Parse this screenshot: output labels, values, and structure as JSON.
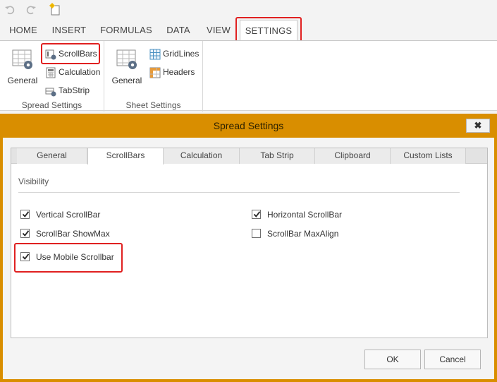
{
  "quick_access": {
    "icons": [
      "undo-icon",
      "redo-icon",
      "new-file-icon"
    ]
  },
  "ribbon_tabs": [
    {
      "label": "HOME"
    },
    {
      "label": "INSERT"
    },
    {
      "label": "FORMULAS"
    },
    {
      "label": "DATA"
    },
    {
      "label": "VIEW"
    },
    {
      "label": "SETTINGS",
      "active": true
    }
  ],
  "ribbon": {
    "spread_settings": {
      "label": "Spread Settings",
      "general": "General",
      "scrollbars": "ScrollBars",
      "calculation": "Calculation",
      "tabstrip": "TabStrip"
    },
    "sheet_settings": {
      "label": "Sheet Settings",
      "general": "General",
      "gridlines": "GridLines",
      "headers": "Headers"
    }
  },
  "dialog": {
    "title": "Spread Settings",
    "close_symbol": "✖",
    "tabs": [
      {
        "label": "General"
      },
      {
        "label": "ScrollBars",
        "active": true
      },
      {
        "label": "Calculation"
      },
      {
        "label": "Tab Strip"
      },
      {
        "label": "Clipboard"
      },
      {
        "label": "Custom Lists"
      }
    ],
    "section_title": "Visibility",
    "options": {
      "vertical_scrollbar": {
        "label": "Vertical ScrollBar",
        "checked": true
      },
      "horizontal_scrollbar": {
        "label": "Horizontal ScrollBar",
        "checked": true
      },
      "scrollbar_showmax": {
        "label": "ScrollBar ShowMax",
        "checked": true
      },
      "scrollbar_maxalign": {
        "label": "ScrollBar MaxAlign",
        "checked": false
      },
      "use_mobile_scrollbar": {
        "label": "Use Mobile Scrollbar",
        "checked": true
      }
    },
    "ok_label": "OK",
    "cancel_label": "Cancel"
  },
  "colors": {
    "dialog_frame": "#d98e00",
    "highlight": "#e02020",
    "ribbon_bg": "#ffffff",
    "icon_blue": "#4a90c2"
  }
}
